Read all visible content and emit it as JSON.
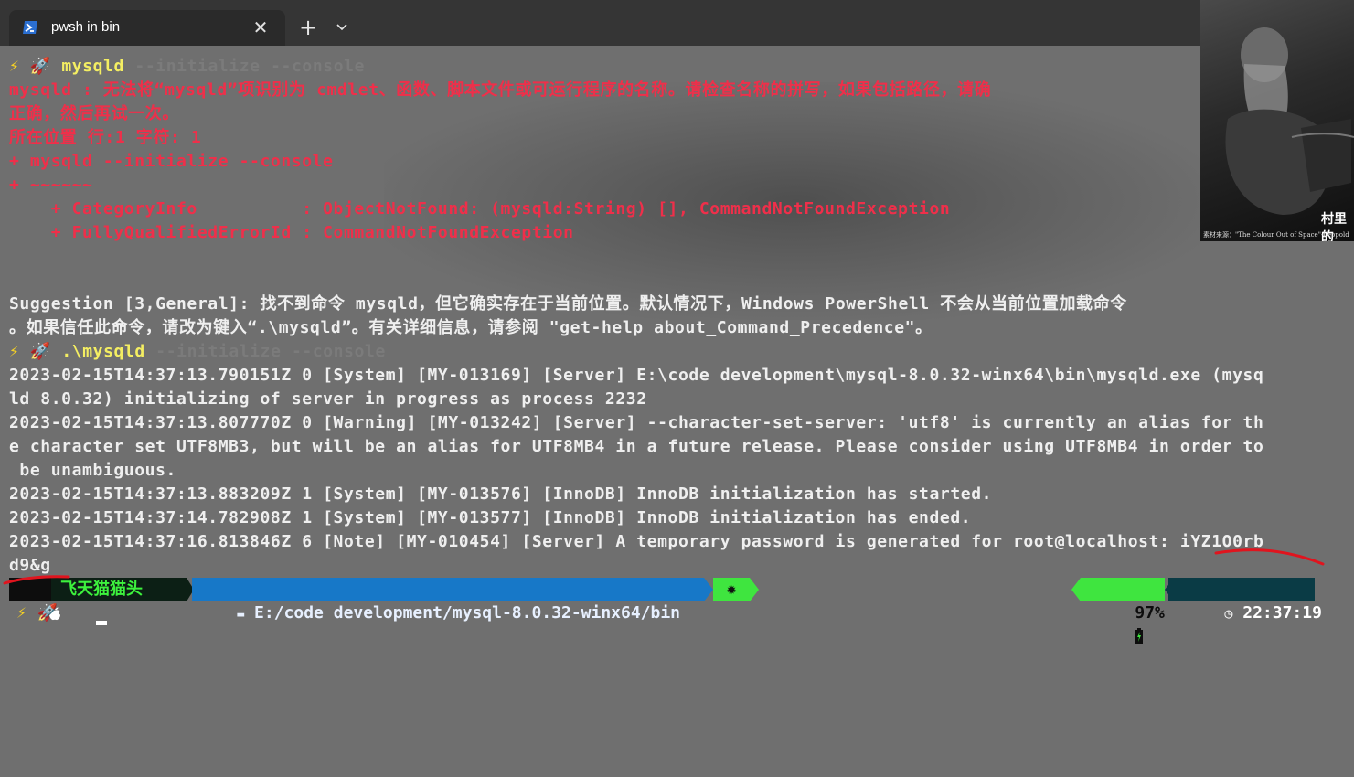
{
  "tab": {
    "title": "pwsh in bin",
    "icon": "powershell-icon",
    "close_icon": "close-icon"
  },
  "tabbar": {
    "new_tab_symbol": "+",
    "dropdown_symbol": "⌄"
  },
  "prompt": {
    "bolt": "⚡",
    "rocket": "🚀"
  },
  "commands": [
    {
      "cmd": "mysqld",
      "args": " --initialize --console"
    },
    {
      "cmd": ".\\mysqld",
      "args": " --initialize --console"
    },
    {
      "cmd": "",
      "args": ""
    }
  ],
  "error": {
    "lines": [
      "mysqld : 无法将“mysqld”项识别为 cmdlet、函数、脚本文件或可运行程序的名称。请检查名称的拼写，如果包括路径，请确",
      "正确，然后再试一次。",
      "所在位置 行:1 字符: 1",
      "+ mysqld --initialize --console",
      "+ ~~~~~~",
      "    + CategoryInfo          : ObjectNotFound: (mysqld:String) [], CommandNotFoundException",
      "    + FullyQualifiedErrorId : CommandNotFoundException"
    ]
  },
  "suggestion": {
    "lines": [
      "Suggestion [3,General]: 找不到命令 mysqld，但它确实存在于当前位置。默认情况下，Windows PowerShell 不会从当前位置加载命令",
      "。如果信任此命令，请改为键入“.\\mysqld”。有关详细信息，请参阅 \"get-help about_Command_Precedence\"。"
    ]
  },
  "output": {
    "lines": [
      "2023-02-15T14:37:13.790151Z 0 [System] [MY-013169] [Server] E:\\code development\\mysql-8.0.32-winx64\\bin\\mysqld.exe (mysq",
      "ld 8.0.32) initializing of server in progress as process 2232",
      "2023-02-15T14:37:13.807770Z 0 [Warning] [MY-013242] [Server] --character-set-server: 'utf8' is currently an alias for th",
      "e character set UTF8MB3, but will be an alias for UTF8MB4 in a future release. Please consider using UTF8MB4 in order to",
      " be unambiguous.",
      "2023-02-15T14:37:13.883209Z 1 [System] [MY-013576] [InnoDB] InnoDB initialization has started.",
      "2023-02-15T14:37:14.782908Z 1 [System] [MY-013577] [InnoDB] InnoDB initialization has ended.",
      "2023-02-15T14:37:16.813846Z 6 [Note] [MY-010454] [Server] A temporary password is generated for root@localhost: iYZ1O0rb",
      "d9&g"
    ]
  },
  "statusline": {
    "apple_icon": "apple-icon",
    "user": "飞天猫猫头",
    "folder_icon": "folder-icon",
    "path": "E:/code development/mysql-8.0.32-winx64/bin",
    "git_icon": "bug-icon",
    "battery": "97%",
    "battery_icon": "battery-charging-icon",
    "clock_icon": "clock-icon",
    "time": "22:37:19"
  },
  "thumbnail": {
    "caption": "村里的",
    "credit": "素材来源：\"The Colour Out of Space\"-Leopold"
  },
  "colors": {
    "background": "#6f6f6f",
    "error": "#ef2f4a",
    "command": "#f4ee62",
    "path_segment": "#1778c8",
    "green_segment": "#3fe53f",
    "time_segment": "#0a3b45"
  }
}
